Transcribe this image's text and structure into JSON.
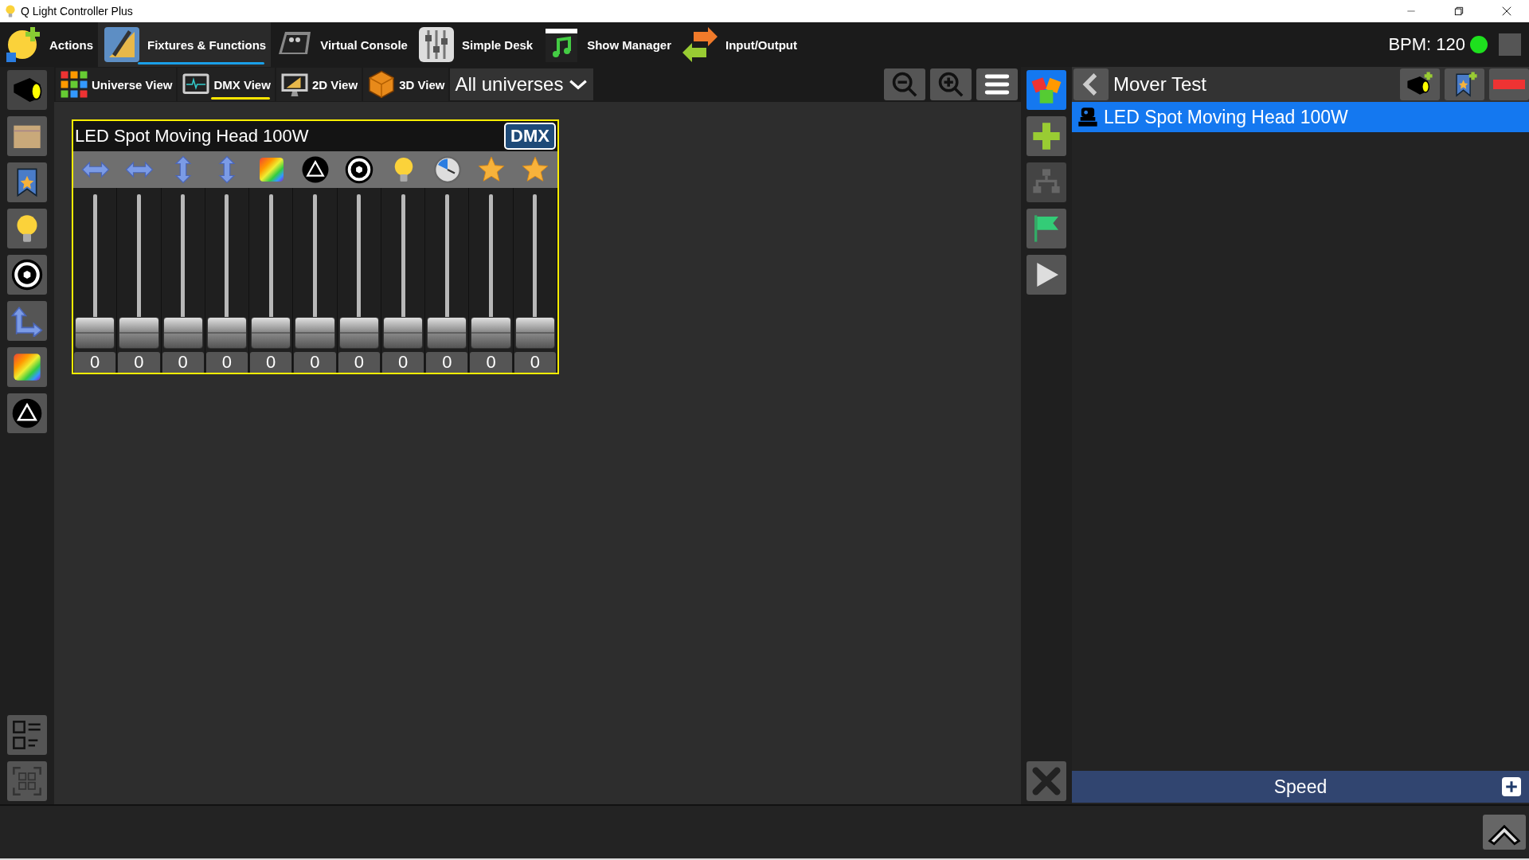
{
  "window": {
    "title": "Q Light Controller Plus"
  },
  "main_tabs": [
    {
      "label": "Actions",
      "kind": "actions",
      "selected": false
    },
    {
      "label": "Fixtures & Functions",
      "kind": "fixtures",
      "selected": true
    },
    {
      "label": "Virtual Console",
      "kind": "console",
      "selected": false
    },
    {
      "label": "Simple Desk",
      "kind": "desk",
      "selected": false
    },
    {
      "label": "Show Manager",
      "kind": "show",
      "selected": false
    },
    {
      "label": "Input/Output",
      "kind": "io",
      "selected": false
    }
  ],
  "bpm": {
    "label": "BPM: 120",
    "active": true
  },
  "view_tabs": [
    {
      "label": "Universe View",
      "kind": "universe",
      "selected": false
    },
    {
      "label": "DMX View",
      "kind": "dmx",
      "selected": true
    },
    {
      "label": "2D View",
      "kind": "flat",
      "selected": false
    },
    {
      "label": "3D View",
      "kind": "solid",
      "selected": false
    }
  ],
  "universe_dropdown": {
    "value": "All universes"
  },
  "fixture_card": {
    "title": "LED Spot Moving Head 100W",
    "mode_badge": "DMX",
    "selected": true,
    "channels": [
      {
        "kind": "pan",
        "value": "0",
        "level": 0
      },
      {
        "kind": "pan",
        "value": "0",
        "level": 0
      },
      {
        "kind": "tilt",
        "value": "0",
        "level": 0
      },
      {
        "kind": "tilt",
        "value": "0",
        "level": 0
      },
      {
        "kind": "color",
        "value": "0",
        "level": 0
      },
      {
        "kind": "prism",
        "value": "0",
        "level": 0
      },
      {
        "kind": "gobo",
        "value": "0",
        "level": 0
      },
      {
        "kind": "intensity",
        "value": "0",
        "level": 0
      },
      {
        "kind": "speed",
        "value": "0",
        "level": 0
      },
      {
        "kind": "effect",
        "value": "0",
        "level": 0
      },
      {
        "kind": "effect",
        "value": "0",
        "level": 0
      }
    ]
  },
  "function_panel": {
    "title": "Mover Test",
    "items": [
      {
        "label": "LED Spot Moving Head 100W",
        "selected": true
      }
    ],
    "speed_bar": {
      "label": "Speed"
    }
  }
}
